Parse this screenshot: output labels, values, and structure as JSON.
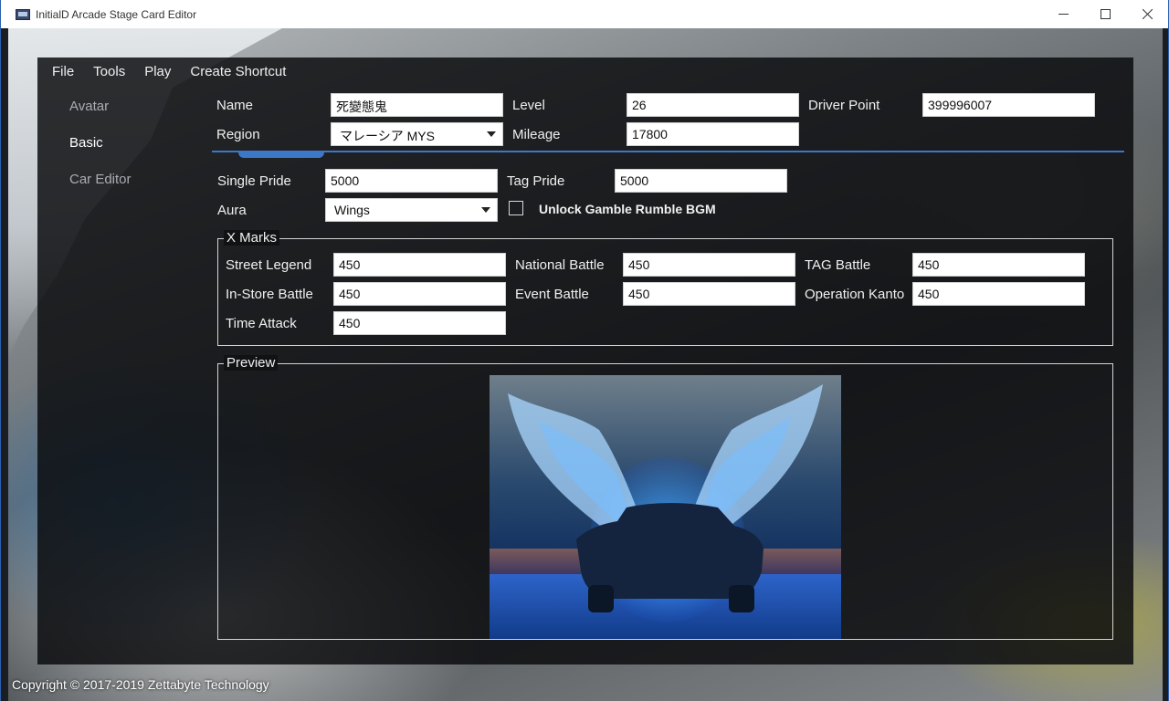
{
  "window": {
    "title": "InitialD Arcade Stage Card Editor"
  },
  "menu": [
    "File",
    "Tools",
    "Play",
    "Create Shortcut"
  ],
  "nav": [
    "Avatar",
    "Basic",
    "Car Editor"
  ],
  "basic": {
    "name_label": "Name",
    "name_value": "死變態鬼",
    "level_label": "Level",
    "level_value": "26",
    "driver_point_label": "Driver Point",
    "driver_point_value": "399996007",
    "region_label": "Region",
    "region_value": "マレーシア MYS",
    "mileage_label": "Mileage",
    "mileage_value": "17800",
    "single_pride_label": "Single Pride",
    "single_pride_value": "5000",
    "tag_pride_label": "Tag Pride",
    "tag_pride_value": "5000",
    "aura_label": "Aura",
    "aura_value": "Wings",
    "unlock_bgm_label": "Unlock Gamble Rumble BGM"
  },
  "xmarks": {
    "title": "X Marks",
    "street_legend_label": "Street Legend",
    "street_legend_value": "450",
    "national_battle_label": "National Battle",
    "national_battle_value": "450",
    "tag_battle_label": "TAG Battle",
    "tag_battle_value": "450",
    "in_store_battle_label": "In-Store Battle",
    "in_store_battle_value": "450",
    "event_battle_label": "Event Battle",
    "event_battle_value": "450",
    "operation_kanto_label": "Operation Kanto",
    "operation_kanto_value": "450",
    "time_attack_label": "Time Attack",
    "time_attack_value": "450"
  },
  "preview": {
    "title": "Preview"
  },
  "footer": {
    "copyright": "Copyright © 2017-2019 Zettabyte Technology"
  },
  "colors": {
    "accent": "#3d77c8",
    "panel": "#0a0b0d"
  }
}
